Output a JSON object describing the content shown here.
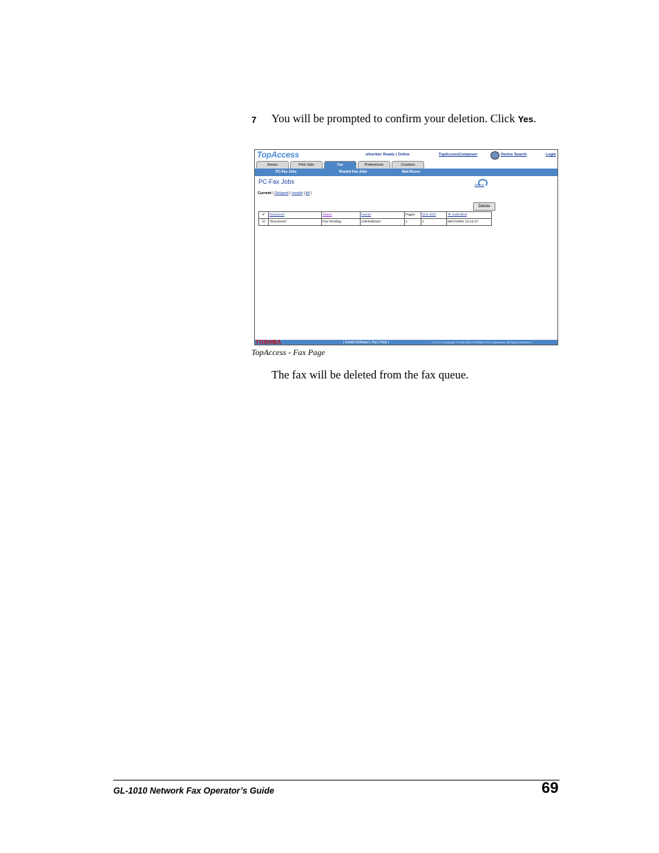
{
  "step": {
    "number": "7",
    "text_before": "You will be prompted to confirm your deletion. Click ",
    "keyword": "Yes",
    "text_after": "."
  },
  "screenshot": {
    "logo": "TopAccess",
    "status": "silverkat: Ready | Online",
    "composer_link": "TopAccessComposer",
    "device_search_link": "Device Search",
    "login_link": "Login",
    "tabs": [
      "Device",
      "Print Jobs",
      "Fax",
      "Preferences",
      "Counters"
    ],
    "subnav": [
      "PC-Fax Jobs",
      "Routed Fax Jobs",
      "Mail Boxes"
    ],
    "page_title": "PC-Fax Jobs",
    "refresh_label": "Refresh",
    "filters": {
      "current": "Current",
      "delayed": "Delayed",
      "invalid": "Invalid",
      "all": "All"
    },
    "delete_label": "Delete",
    "table": {
      "headers": [
        "Document",
        "Status",
        "Owner",
        "Pages",
        "Size (Kb)",
        "Submitted"
      ],
      "rows": [
        {
          "check": "☑",
          "document": "\"Document\"",
          "status": "Fax Pending",
          "owner": "Administrator",
          "pages": "1",
          "size": "1",
          "submitted": "06/17/2001 14:12:17"
        }
      ]
    },
    "footer": {
      "brand": "TOSHIBA",
      "links": "| Install Software | Top | Help |",
      "copyright": "V1.3.2.1   Copyright © 1998-2001 TOSHIBA TEC Corporation. All Rights Reserved"
    }
  },
  "caption": "TopAccess - Fax Page",
  "paragraph": "The fax will be deleted from the fax queue.",
  "footer": {
    "title": "GL-1010 Network Fax Operator’s Guide",
    "page_number": "69"
  }
}
